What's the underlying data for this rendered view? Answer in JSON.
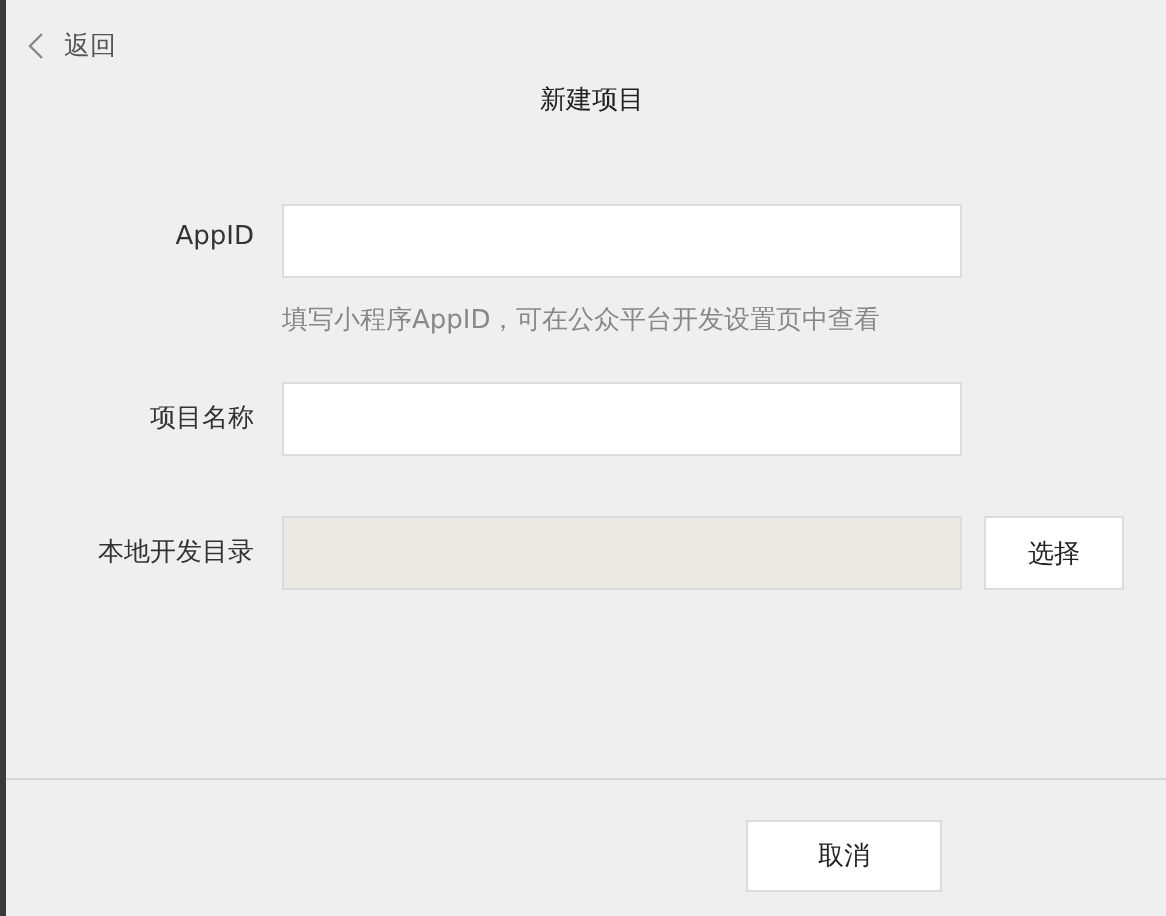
{
  "back": {
    "label": "返回"
  },
  "title": "新建项目",
  "fields": [
    {
      "label": "AppID",
      "kind": "text",
      "hint": "填写小程序AppID，可在公众平台开发设置页中查看"
    },
    {
      "label": "项目名称",
      "kind": "text"
    },
    {
      "label": "本地开发目录",
      "kind": "readonly",
      "button": "选择"
    }
  ],
  "buttons": [
    "取消"
  ]
}
